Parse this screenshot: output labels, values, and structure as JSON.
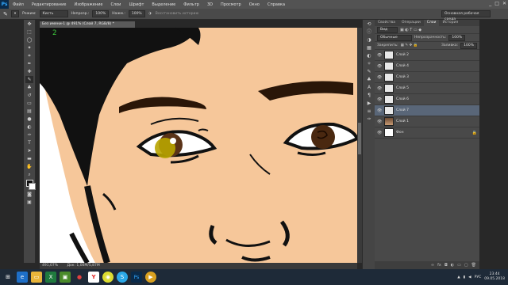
{
  "app": {
    "logo": "Ps"
  },
  "menu": [
    "Файл",
    "Редактирование",
    "Изображение",
    "Слои",
    "Шрифт",
    "Выделение",
    "Фильтр",
    "3D",
    "Просмотр",
    "Окно",
    "Справка"
  ],
  "window_controls": [
    "_",
    "□",
    "✕"
  ],
  "options": {
    "mode_label": "Режим:",
    "mode_value": "Кисть",
    "opacity_label": "Непрозр.:",
    "opacity_value": "100%",
    "flow_label": "Нажм.:",
    "flow_value": "100%",
    "restore_label": "Восстановить историю",
    "workspace": "Основная рабочая среда"
  },
  "document": {
    "tab": "Без имени-1 @ 491% (Слой 7, RGB/8) *",
    "zoom": "491,07%",
    "status": "Док: 1,00M/5,87M",
    "canvas_note": "2"
  },
  "panel": {
    "tabs": [
      "Свойства",
      "Операции",
      "Слои",
      "История"
    ],
    "active_tab": "Слои",
    "kind_label": "Вид",
    "blend_mode": "Обычные",
    "opacity_label": "Непрозрачность:",
    "opacity_value": "100%",
    "lock_label": "Закрепить:",
    "fill_label": "Заливка:",
    "fill_value": "100%",
    "layers": [
      {
        "name": "Слой 2",
        "selected": false,
        "thumb": "plain"
      },
      {
        "name": "Слой 4",
        "selected": false,
        "thumb": "plain"
      },
      {
        "name": "Слой 3",
        "selected": false,
        "thumb": "plain"
      },
      {
        "name": "Слой 5",
        "selected": false,
        "thumb": "plain"
      },
      {
        "name": "Слой 6",
        "selected": false,
        "thumb": "plain"
      },
      {
        "name": "Слой 7",
        "selected": true,
        "thumb": "plain"
      },
      {
        "name": "Слой 1",
        "selected": false,
        "thumb": "photo"
      },
      {
        "name": "Фон",
        "selected": false,
        "thumb": "white",
        "locked": true
      }
    ]
  },
  "taskbar": {
    "lang": "РУС",
    "time": "23:44",
    "date": "09.05.2018"
  }
}
